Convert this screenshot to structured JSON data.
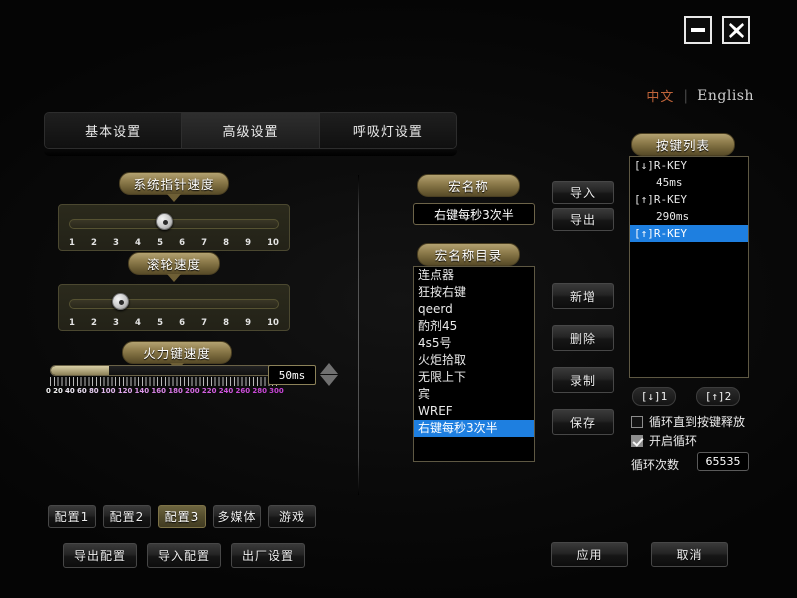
{
  "window": {
    "minimize_icon": "minimize-icon",
    "close_icon": "close-icon"
  },
  "language": {
    "chinese": "中文",
    "separator": "|",
    "english": "English",
    "active_color": "#c0643a"
  },
  "tabs": [
    {
      "label": "基本设置",
      "active": false
    },
    {
      "label": "高级设置",
      "active": true
    },
    {
      "label": "呼吸灯设置",
      "active": false
    }
  ],
  "sliders": {
    "pointer": {
      "title": "系统指针速度",
      "value": 5,
      "ticks": [
        "1",
        "2",
        "3",
        "4",
        "5",
        "6",
        "7",
        "8",
        "9",
        "10"
      ]
    },
    "wheel": {
      "title": "滚轮速度",
      "value": 3,
      "ticks": [
        "1",
        "2",
        "3",
        "4",
        "5",
        "6",
        "7",
        "8",
        "9",
        "10"
      ]
    },
    "fire": {
      "title": "火力键速度",
      "value_label": "50ms",
      "value": 50,
      "min": 0,
      "max": 300,
      "ticks": [
        "0",
        "20",
        "40",
        "60",
        "80",
        "100",
        "120",
        "140",
        "160",
        "180",
        "200",
        "220",
        "240",
        "260",
        "280",
        "300"
      ]
    }
  },
  "macro": {
    "name_label": "宏名称",
    "name_value": "右键每秒3次半",
    "import_button": "导入",
    "export_button": "导出",
    "list_label": "宏名称目录",
    "list_items": [
      {
        "label": "连点器",
        "selected": false
      },
      {
        "label": "狂按右键",
        "selected": false
      },
      {
        "label": "qeerd",
        "selected": false
      },
      {
        "label": "酌剂45",
        "selected": false
      },
      {
        "label": "4s5号",
        "selected": false
      },
      {
        "label": "火炬拾取",
        "selected": false
      },
      {
        "label": "无限上下",
        "selected": false
      },
      {
        "label": "宾",
        "selected": false
      },
      {
        "label": "WREF",
        "selected": false
      },
      {
        "label": "右键每秒3次半",
        "selected": true
      }
    ],
    "actions": [
      {
        "label": "新增"
      },
      {
        "label": "删除"
      },
      {
        "label": "录制"
      },
      {
        "label": "保存"
      }
    ]
  },
  "keylist": {
    "title": "按键列表",
    "items": [
      {
        "label": "[↓]R-KEY",
        "indent": false,
        "selected": false
      },
      {
        "label": "45ms",
        "indent": true,
        "selected": false
      },
      {
        "label": "[↑]R-KEY",
        "indent": false,
        "selected": false
      },
      {
        "label": "290ms",
        "indent": true,
        "selected": false
      },
      {
        "label": "[↑]R-KEY",
        "indent": false,
        "selected": true
      }
    ],
    "down_button": "[↓]1",
    "up_button": "[↑]2",
    "loop_until_release_label": "循环直到按键释放",
    "loop_until_release_checked": false,
    "enable_loop_label": "开启循环",
    "enable_loop_checked": true,
    "loop_count_label": "循环次数",
    "loop_count_value": "65535"
  },
  "profiles": [
    {
      "label": "配置1",
      "active": false
    },
    {
      "label": "配置2",
      "active": false
    },
    {
      "label": "配置3",
      "active": true
    },
    {
      "label": "多媒体",
      "active": false
    },
    {
      "label": "游戏",
      "active": false
    }
  ],
  "config_actions": [
    {
      "label": "导出配置"
    },
    {
      "label": "导入配置"
    },
    {
      "label": "出厂设置"
    }
  ],
  "footer": {
    "apply": "应用",
    "cancel": "取消"
  }
}
